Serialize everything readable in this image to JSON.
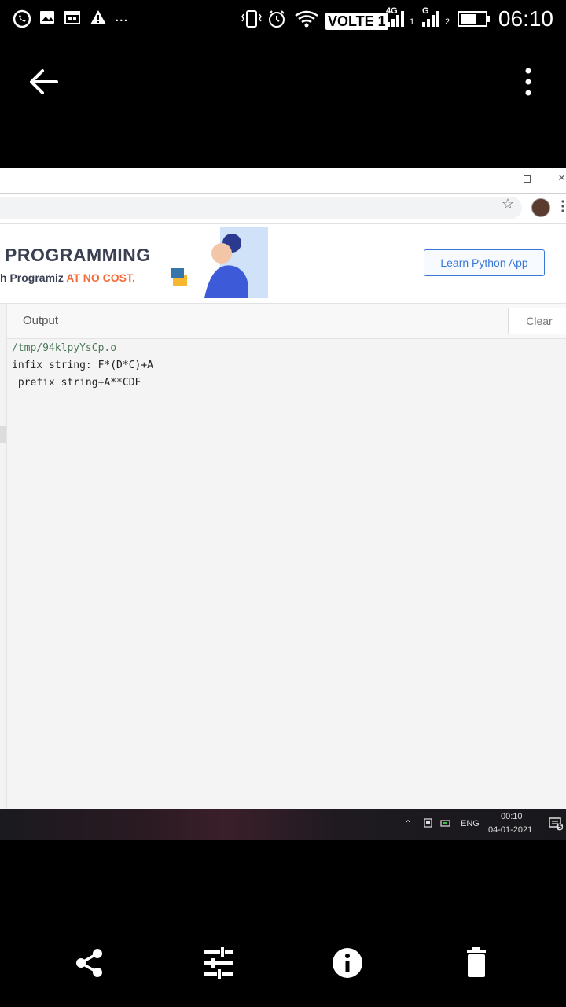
{
  "status_bar": {
    "time": "06:10",
    "volte": "VOLTE 1",
    "net1": "4G",
    "sim1": "1",
    "net2": "G",
    "sim2": "2",
    "overflow": "..."
  },
  "browser": {
    "ad": {
      "headline": "PROGRAMMING?",
      "sub_prefix": "h Programiz ",
      "sub_highlight": "AT NO COST.",
      "button": "Learn Python App"
    },
    "output": {
      "label": "Output",
      "clear_label": "Clear",
      "lines": [
        "/tmp/94klpyYsCp.o",
        "infix string: F*(D*C)+A",
        " prefix string+A**CDF"
      ]
    },
    "taskbar": {
      "lang": "ENG",
      "time": "00:10",
      "date": "04-01-2021",
      "notif_count": "5"
    }
  },
  "colors": {
    "accent": "#3a78d6",
    "highlight": "#f46b3a",
    "path_text": "#4d7a5c"
  }
}
